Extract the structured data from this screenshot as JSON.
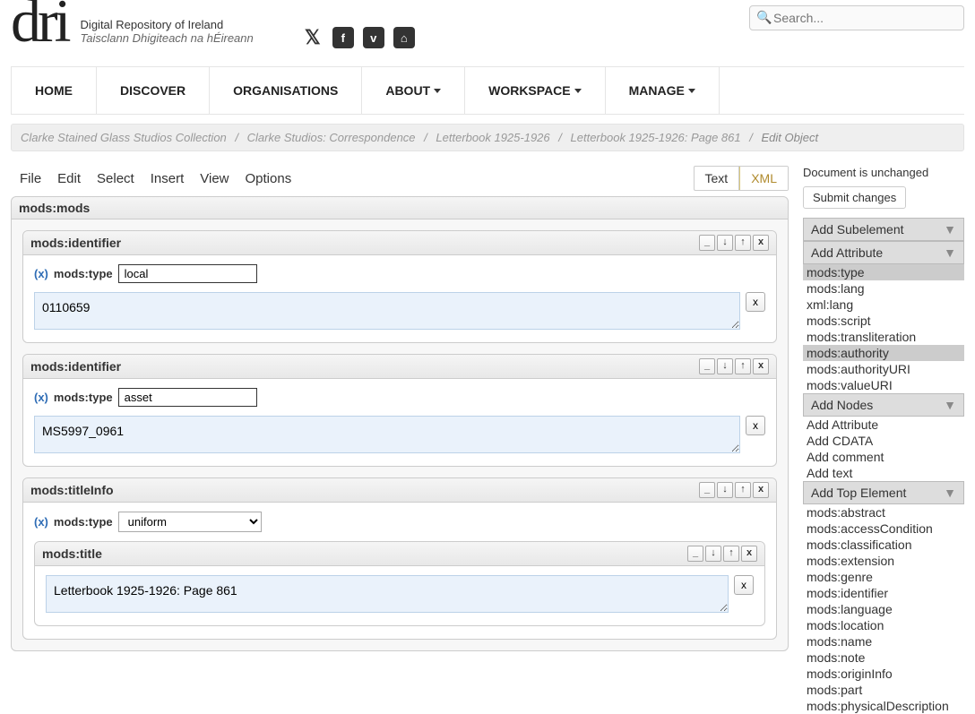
{
  "header": {
    "logo_text": "dri",
    "sub1": "Digital Repository of Ireland",
    "sub2": "Taisclann Dhigiteach na hÉireann",
    "search_placeholder": "Search..."
  },
  "nav": {
    "home": "HOME",
    "discover": "DISCOVER",
    "organisations": "ORGANISATIONS",
    "about": "ABOUT",
    "workspace": "WORKSPACE",
    "manage": "MANAGE"
  },
  "breadcrumb": {
    "c0": "Clarke Stained Glass Studios Collection",
    "c1": "Clarke Studios: Correspondence",
    "c2": "Letterbook 1925-1926",
    "c3": "Letterbook 1925-1926: Page 861",
    "c4": "Edit Object"
  },
  "editor_menu": {
    "file": "File",
    "edit": "Edit",
    "select": "Select",
    "insert": "Insert",
    "view": "View",
    "options": "Options"
  },
  "view_tabs": {
    "text": "Text",
    "xml": "XML"
  },
  "root_label": "mods:mods",
  "blocks": {
    "id1": {
      "header": "mods:identifier",
      "attr_label": "mods:type",
      "attr_value": "local",
      "value": "0110659"
    },
    "id2": {
      "header": "mods:identifier",
      "attr_label": "mods:type",
      "attr_value": "asset",
      "value": "MS5997_0961"
    },
    "titleInfo": {
      "header": "mods:titleInfo",
      "attr_label": "mods:type",
      "attr_value": "uniform",
      "title_header": "mods:title",
      "title_value": "Letterbook 1925-1926: Page 861"
    }
  },
  "controls": {
    "min": "_",
    "down": "↓",
    "up": "↑",
    "close": "x"
  },
  "side": {
    "status": "Document is unchanged",
    "submit": "Submit changes",
    "sub_head": "Add Subelement",
    "attr_head": "Add Attribute",
    "attrs": [
      "mods:type",
      "mods:lang",
      "xml:lang",
      "mods:script",
      "mods:transliteration",
      "mods:authority",
      "mods:authorityURI",
      "mods:valueURI"
    ],
    "attrs_hl": {
      "0": true,
      "5": true
    },
    "nodes_head": "Add Nodes",
    "nodes": [
      "Add Attribute",
      "Add CDATA",
      "Add comment",
      "Add text"
    ],
    "top_head": "Add Top Element",
    "top": [
      "mods:abstract",
      "mods:accessCondition",
      "mods:classification",
      "mods:extension",
      "mods:genre",
      "mods:identifier",
      "mods:language",
      "mods:location",
      "mods:name",
      "mods:note",
      "mods:originInfo",
      "mods:part",
      "mods:physicalDescription"
    ]
  }
}
